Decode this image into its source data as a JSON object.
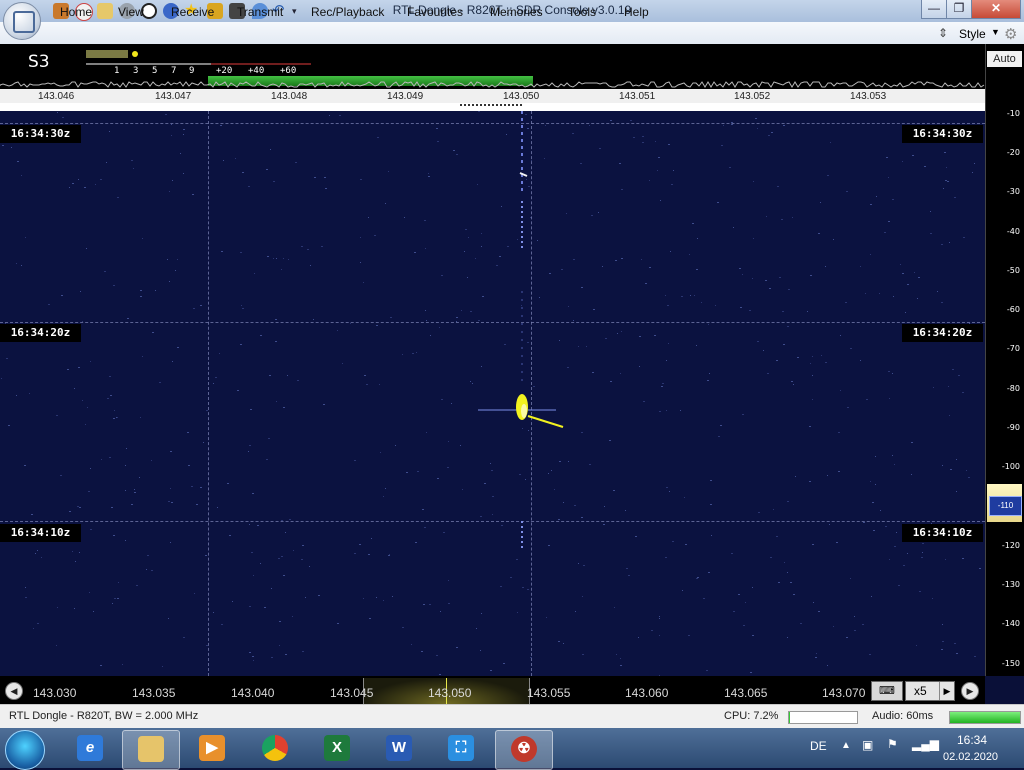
{
  "window": {
    "title": "RTL Dongle - R820T :: SDR Console v3.0.19",
    "minimize": "—",
    "maximize": "❐",
    "close": "✕"
  },
  "menu": {
    "items": [
      "Home",
      "View",
      "Receive",
      "Transmit",
      "Rec/Playback",
      "Favourites",
      "Memories",
      "Tools",
      "Help"
    ],
    "style_label": "Style"
  },
  "smeter": {
    "readout": "S3",
    "scale": [
      "1",
      "3",
      "5",
      "7",
      "9",
      "+20",
      "+40",
      "+60"
    ]
  },
  "spectrum": {
    "freq_ticks": [
      "143.046",
      "143.047",
      "143.048",
      "143.049",
      "143.050",
      "143.051",
      "143.052",
      "143.053"
    ]
  },
  "waterfall": {
    "time_labels": [
      "16:34:30z",
      "16:34:20z",
      "16:34:10z"
    ]
  },
  "db_scale": {
    "auto_label": "Auto",
    "labels": [
      "-10",
      "-20",
      "-30",
      "-40",
      "-50",
      "-60",
      "-70",
      "-80",
      "-90",
      "-100",
      "-110",
      "-120",
      "-130",
      "-140",
      "-150"
    ],
    "selected": "-110"
  },
  "bottom_scale": {
    "freq_ticks": [
      "143.030",
      "143.035",
      "143.040",
      "143.045",
      "143.050",
      "143.055",
      "143.060",
      "143.065",
      "143.070"
    ],
    "zoom": "x5",
    "zoom_arrow": "▶",
    "prev_symbol": "◀",
    "next_symbol": "▶",
    "keyboard_symbol": "⌨"
  },
  "status": {
    "device": "RTL Dongle - R820T, BW = 2.000 MHz",
    "cpu": "CPU: 7.2%",
    "audio": "Audio: 60ms",
    "cpu_fraction": 0.02,
    "audio_fraction": 1.0
  },
  "taskbar": {
    "language": "DE",
    "time": "16:34",
    "date": "02.02.2020",
    "apps": [
      "ie",
      "file-explorer",
      "media-player",
      "chrome",
      "excel",
      "word",
      "snipping",
      "sdr-console"
    ]
  },
  "colors": {
    "waterfall_bg": "#0b1240",
    "signal": "#f2f21f",
    "spectrum_green": "#2fc12f"
  }
}
